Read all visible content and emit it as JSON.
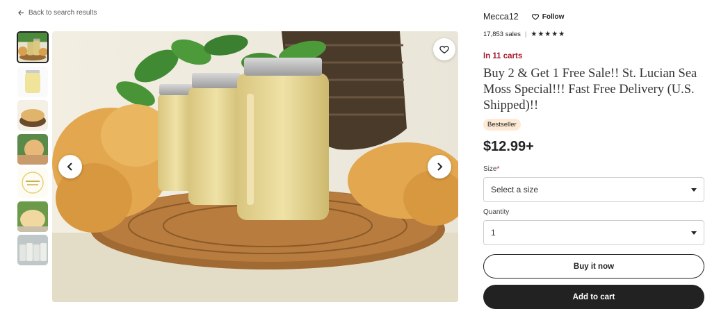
{
  "nav": {
    "back_label": "Back to search results"
  },
  "gallery": {
    "thumbnails": [
      "thumb-jars-basket",
      "thumb-single-jar",
      "thumb-sea-moss-bowl",
      "thumb-sea-moss-hand",
      "thumb-promo-card",
      "thumb-sea-moss-closeup",
      "thumb-jar-row"
    ],
    "active_index": 0
  },
  "shop": {
    "name": "Mecca12",
    "follow_label": "Follow",
    "sales": "17,853 sales",
    "rating_stars": 5
  },
  "listing": {
    "in_carts": "In 11 carts",
    "title": "Buy 2 & Get 1 Free Sale!! St. Lucian Sea Moss Special!!! Fast Free Delivery (U.S. Shipped)!!",
    "badge": "Bestseller",
    "price": "$12.99+"
  },
  "form": {
    "size_label": "Size",
    "size_required_mark": "*",
    "size_value": "Select a size",
    "quantity_label": "Quantity",
    "quantity_value": "1"
  },
  "actions": {
    "buy_now_label": "Buy it now",
    "add_to_cart_label": "Add to cart"
  },
  "colors": {
    "accent_red": "#a61a2e",
    "badge_bg": "#fde9d4",
    "primary_dark": "#222222"
  }
}
